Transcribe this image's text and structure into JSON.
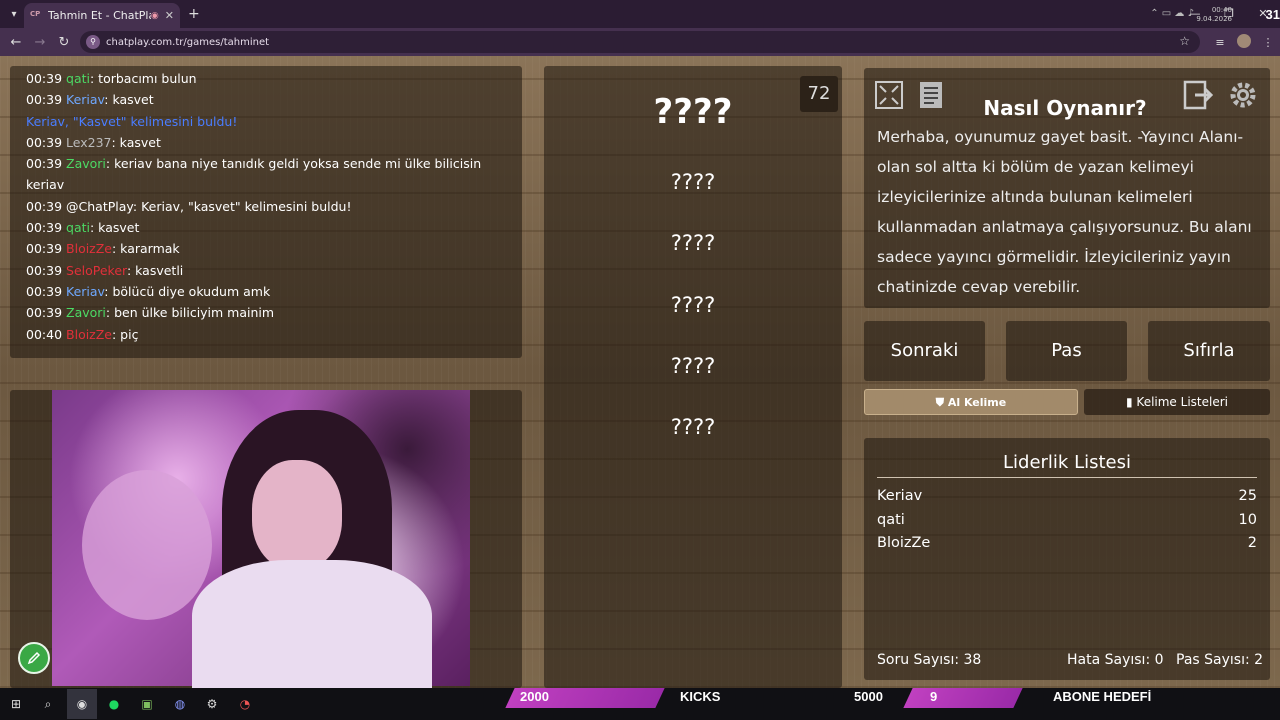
{
  "browser": {
    "tab_title": "Tahmin Et - ChatPlay",
    "favicon_text": "CP",
    "url": "chatplay.com.tr/games/tahminet"
  },
  "chat": {
    "lines": [
      {
        "time": "00:39",
        "user": "qati",
        "color": "#4cd964",
        "text": ": torbacımı bulun"
      },
      {
        "time": "00:39",
        "user": "Keriav",
        "color": "#6fa8ff",
        "text": ": kasvet"
      },
      {
        "time": "",
        "user": "Keriav, \"Kasvet\" kelimesini buldu!",
        "color": "#4a7dff",
        "text": ""
      },
      {
        "time": "00:39",
        "user": "Lex237",
        "color": "#bbbbbb",
        "text": ": kasvet"
      },
      {
        "time": "00:39",
        "user": "Zavori",
        "color": "#4cd964",
        "text": ": keriav bana niye tanıdık geldi yoksa sende mi ülke bilicisin keriav"
      },
      {
        "time": "00:39",
        "user": "@ChatPlay",
        "color": "#ffffff",
        "text": ": Keriav, \"kasvet\" kelimesini buldu!"
      },
      {
        "time": "00:39",
        "user": "qati",
        "color": "#4cd964",
        "text": ": kasvet"
      },
      {
        "time": "00:39",
        "user": "BloizZe",
        "color": "#e0303a",
        "text": ": kararmak"
      },
      {
        "time": "00:39",
        "user": "SeloPeker",
        "color": "#e0303a",
        "text": ": kasvetli"
      },
      {
        "time": "00:39",
        "user": "Keriav",
        "color": "#6fa8ff",
        "text": ": bölücü diye okudum amk"
      },
      {
        "time": "00:39",
        "user": "Zavori",
        "color": "#4cd964",
        "text": ": ben ülke biliciyim mainim"
      },
      {
        "time": "00:40",
        "user": "BloizZe",
        "color": "#e0303a",
        "text": ": piç"
      }
    ]
  },
  "game": {
    "timer": "72",
    "guesses": [
      "????",
      "????",
      "????",
      "????",
      "????",
      "????"
    ]
  },
  "howto": {
    "title": "Nasıl Oynanır?",
    "text": "Merhaba, oyunumuz gayet basit. -Yayıncı Alanı- olan sol altta ki bölüm de yazan kelimeyi izleyicilerinize altında bulunan kelimeleri kullanmadan anlatmaya çalışıyorsunuz. Bu alanı sadece yayıncı görmelidir. İzleyicileriniz yayın chatinizde cevap verebilir."
  },
  "actions": {
    "next": "Sonraki",
    "pass": "Pas",
    "reset": "Sıfırla",
    "al_kelime": "Al Kelime",
    "kelime_listeleri": "Kelime Listeleri"
  },
  "leaderboard": {
    "title": "Liderlik Listesi",
    "rows": [
      {
        "name": "Keriav",
        "score": "25"
      },
      {
        "name": "qati",
        "score": "10"
      },
      {
        "name": "BloizZe",
        "score": "2"
      }
    ],
    "soru": "Soru Sayısı: 38",
    "hata": "Hata Sayısı: 0",
    "pas": "Pas Sayısı: 2"
  },
  "taskbar": {
    "ticker_1": "2000",
    "ticker_2": "KICKS",
    "ticker_3": "5000",
    "ticker_4": "9",
    "ticker_5": "ABONE HEDEFİ",
    "clock_time": "00:40",
    "clock_date": "9.04.2026",
    "right_num": "31"
  }
}
